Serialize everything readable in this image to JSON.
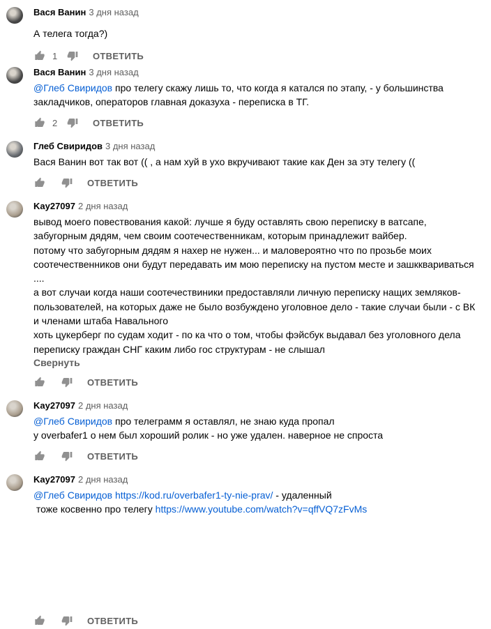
{
  "reply_label": "ОТВЕТИТЬ",
  "comments": [
    {
      "author": "Вася Ванин",
      "time": "3 дня назад",
      "lines": [
        [
          {
            "t": "А телега тогда?)"
          }
        ]
      ],
      "likes": "1"
    },
    {
      "author": "Вася Ванин",
      "time": "3 дня назад",
      "lines": [
        [
          {
            "t": "@Глеб Свиридов",
            "mention": true
          },
          {
            "t": " про телегу скажу лишь то, что когда я катался по этапу, - у большинства"
          }
        ],
        [
          {
            "t": "закладчиков, операторов главная доказуха - переписка в ТГ."
          }
        ]
      ],
      "likes": "2"
    },
    {
      "author": "Глеб Свиридов",
      "time": "3 дня назад",
      "lines": [
        [
          {
            "t": "Вася Ванин вот так вот (( , а нам хуй в ухо вкручивают такие как Ден за эту телегу (("
          }
        ]
      ],
      "likes": ""
    },
    {
      "author": "Kay27097",
      "time": "2 дня назад",
      "lines": [
        [
          {
            "t": "вывод моего повествования какой: лучше я буду оставлять свою переписку в ватсапе,"
          }
        ],
        [
          {
            "t": "забугорным дядям, чем своим соотечественникам, которым принадлежит вайбер."
          }
        ],
        [
          {
            "t": "потому что забугорным дядям я нахер не нужен... и маловероятно что по прозьбе моих"
          }
        ],
        [
          {
            "t": "соотечественников они будут передавать им мою переписку на пустом месте и зашкквариваться"
          }
        ],
        [
          {
            "t": "...."
          }
        ],
        [
          {
            "t": "а вот случаи когда наши соотечествиники предоставляли личную переписку нащих земляков-"
          }
        ],
        [
          {
            "t": "пользователей, на которых даже не было возбуждено уголовное дело - такие случаи были - с ВК"
          }
        ],
        [
          {
            "t": "и членами штаба Навального"
          }
        ],
        [
          {
            "t": "хоть цукерберг по судам ходит - по ка что о том, чтобы фэйсбук выдавал без уголовного дела"
          }
        ],
        [
          {
            "t": "переписку граждан СНГ каким либо гос структурам - не слышал"
          }
        ]
      ],
      "collapse": "Свернуть",
      "likes": ""
    },
    {
      "author": "Kay27097",
      "time": "2 дня назад",
      "lines": [
        [
          {
            "t": "@Глеб Свиридов",
            "mention": true
          },
          {
            "t": " про телеграмм я оставлял, не знаю куда пропал"
          }
        ],
        [
          {
            "t": "у overbafer1 о нем был хороший ролик - но уже удален. наверное не спроста"
          }
        ]
      ],
      "likes": ""
    },
    {
      "author": "Kay27097",
      "time": "2 дня назад",
      "lines": [
        [
          {
            "t": "@Глеб Свиридов",
            "mention": true
          },
          {
            "t": " "
          },
          {
            "t": "https://kod.ru/overbafer1-ty-nie-prav/",
            "mention": true
          },
          {
            "t": " - удаленный"
          }
        ],
        [
          {
            "t": " тоже косвенно про телегу "
          },
          {
            "t": "https://www.youtube.com/watch?v=qffVQ7zFvMs",
            "mention": true
          }
        ]
      ],
      "likes": ""
    }
  ]
}
